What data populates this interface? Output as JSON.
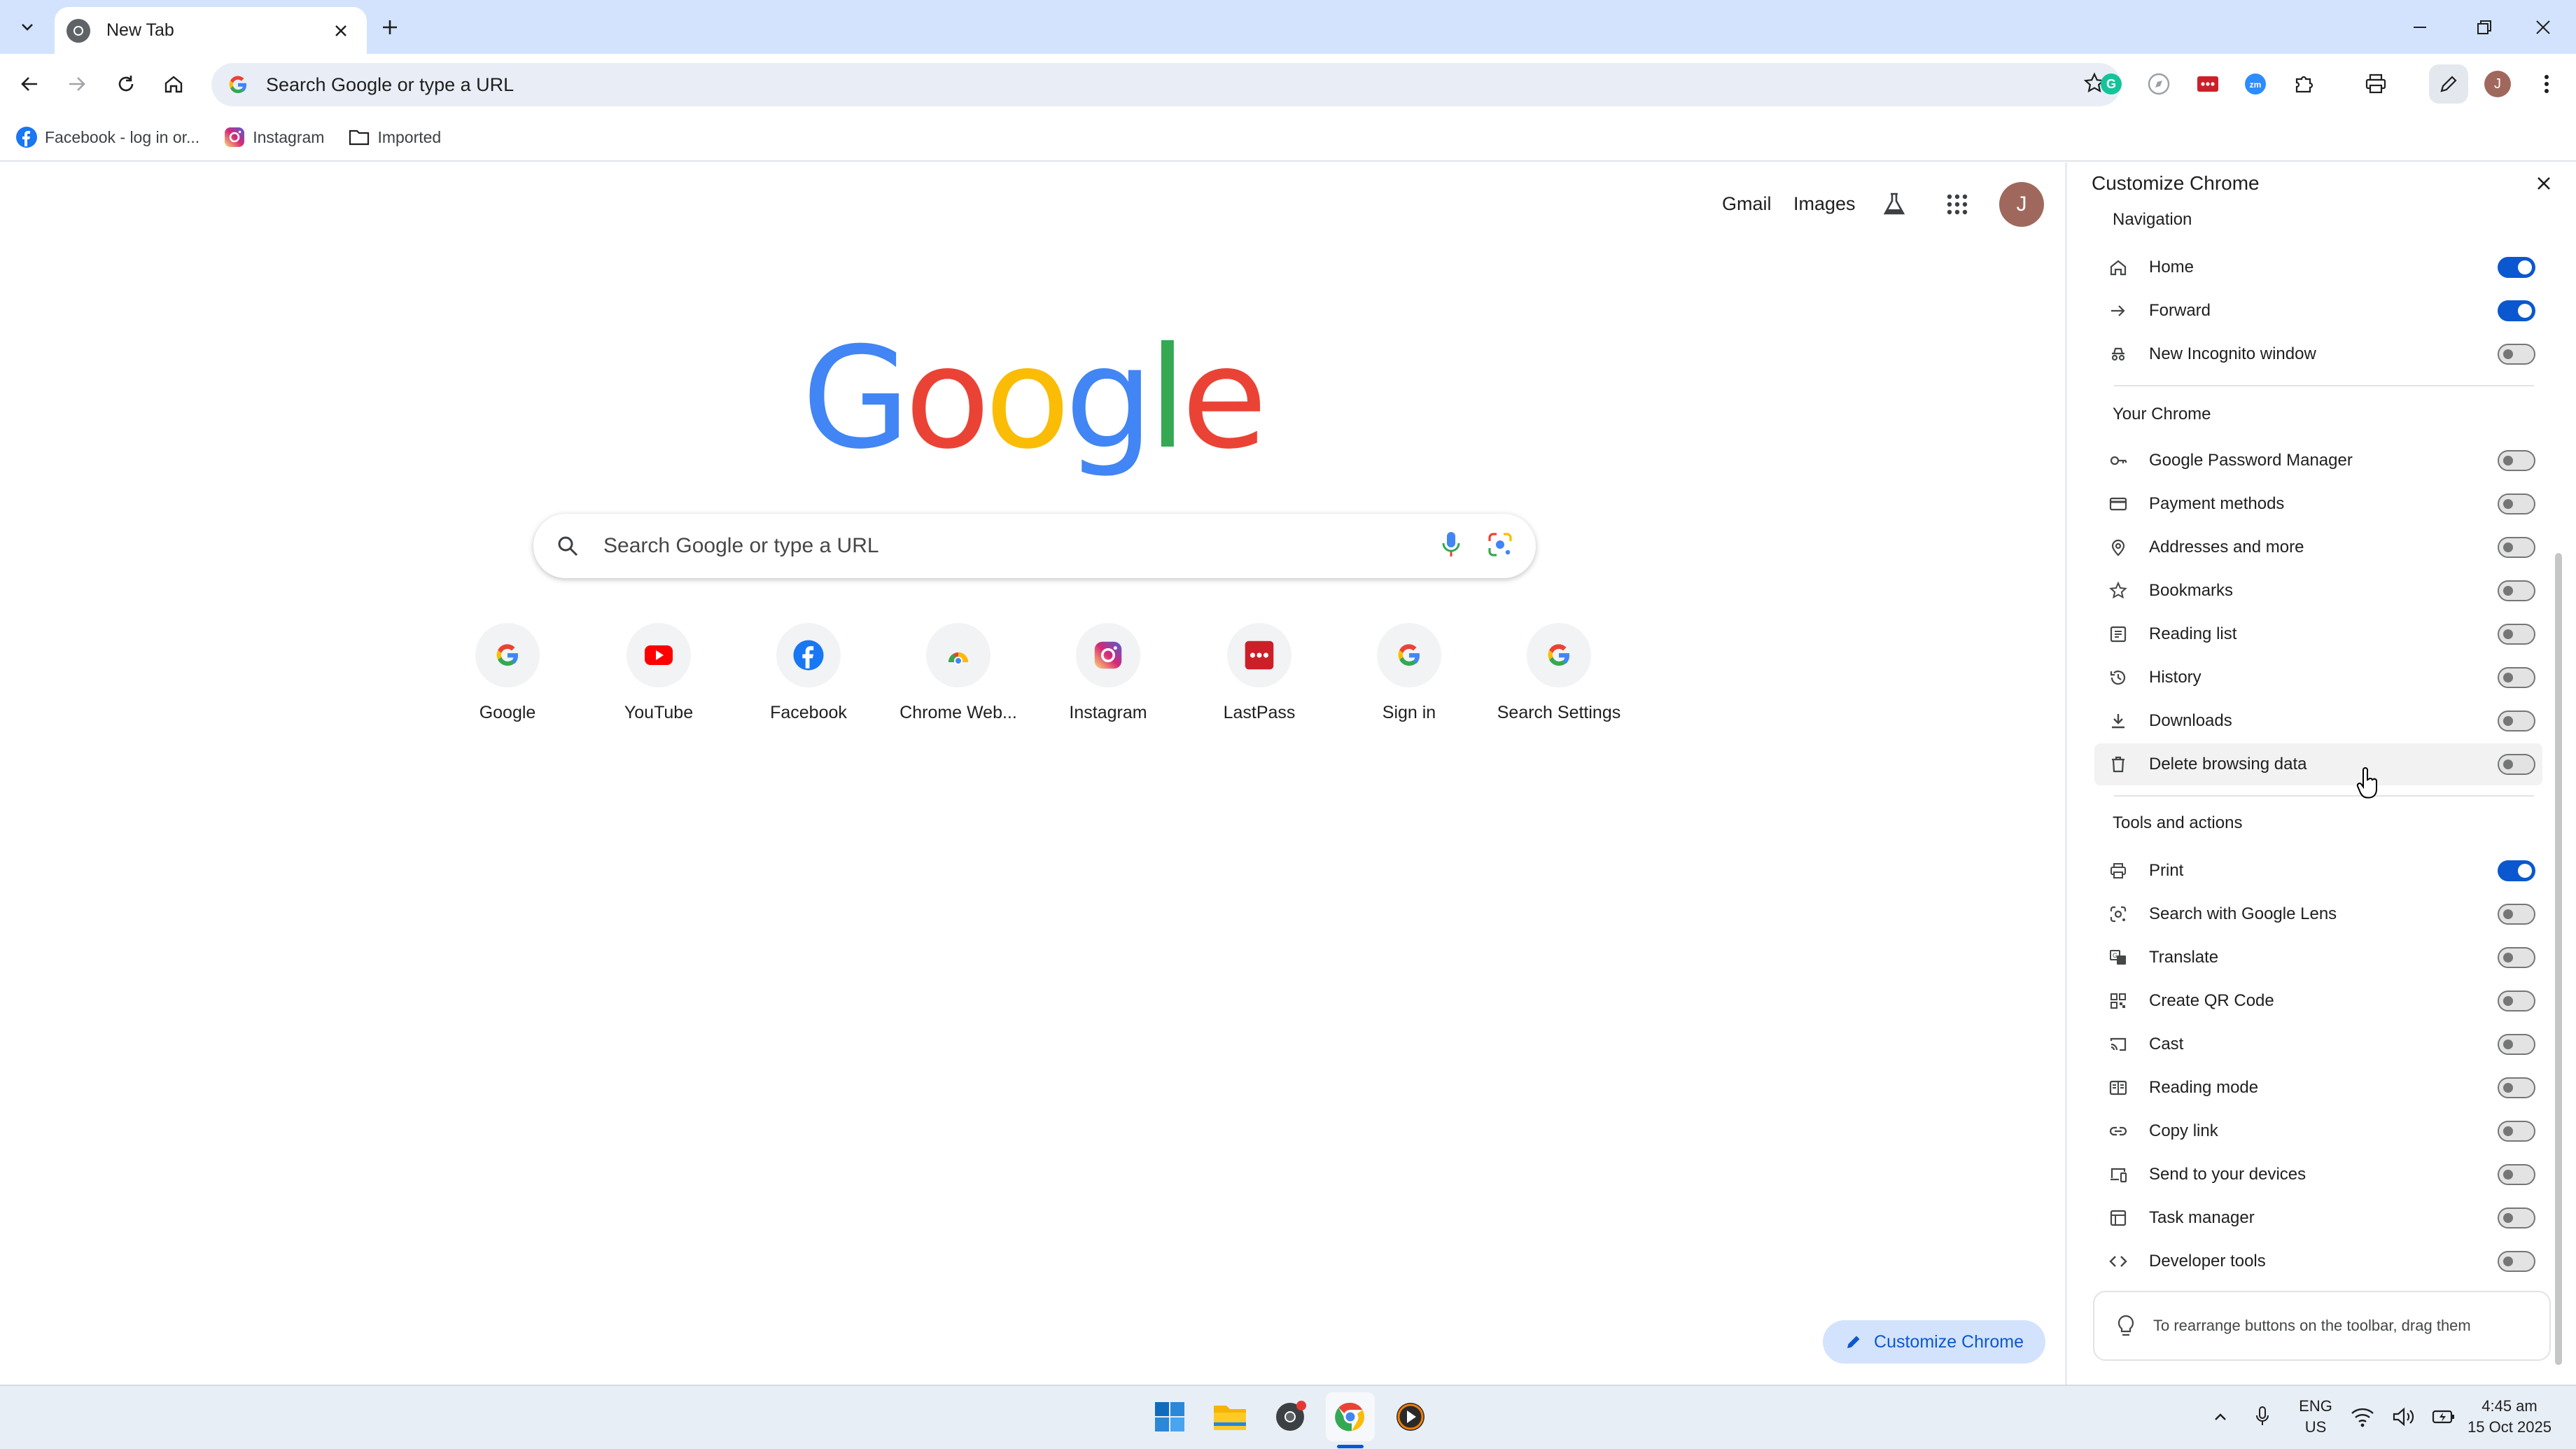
{
  "colors": {
    "tabstrip_bg": "#d3e3fd",
    "accent": "#0b57d0",
    "google_blue": "#4285F4",
    "google_red": "#EA4335",
    "google_yellow": "#FBBC05",
    "google_green": "#34A853",
    "avatar_bg": "#a0685c"
  },
  "tab": {
    "title": "New Tab",
    "favicon": "chrome-icon"
  },
  "toolbar": {
    "omnibox_placeholder": "Search Google or type a URL",
    "avatar_letter": "J",
    "icons": [
      "back-icon",
      "forward-icon",
      "reload-icon",
      "home-icon",
      "bookmark-star-icon",
      "extension-grammarly-icon",
      "extension-compass-icon",
      "extension-lastpass-icon",
      "extension-zoom-icon",
      "extensions-puzzle-icon",
      "print-icon",
      "customize-pencil-icon",
      "profile-avatar",
      "menu-kebab-icon"
    ]
  },
  "bookmarks": [
    {
      "label": "Facebook - log in or...",
      "icon": "facebook-icon"
    },
    {
      "label": "Instagram",
      "icon": "instagram-icon"
    },
    {
      "label": "Imported",
      "icon": "folder-icon"
    }
  ],
  "ntp": {
    "links": {
      "gmail": "Gmail",
      "images": "Images"
    },
    "avatar_letter": "J",
    "logo_letters": [
      "G",
      "o",
      "o",
      "g",
      "l",
      "e"
    ],
    "search_placeholder": "Search Google or type a URL",
    "shortcuts": [
      {
        "label": "Google",
        "icon": "google-g-icon"
      },
      {
        "label": "YouTube",
        "icon": "youtube-icon"
      },
      {
        "label": "Facebook",
        "icon": "facebook-icon"
      },
      {
        "label": "Chrome Web...",
        "icon": "chrome-web-store-icon"
      },
      {
        "label": "Instagram",
        "icon": "instagram-icon"
      },
      {
        "label": "LastPass",
        "icon": "lastpass-icon"
      },
      {
        "label": "Sign in",
        "icon": "google-g-icon"
      },
      {
        "label": "Search Settings",
        "icon": "google-g-icon"
      }
    ],
    "customize_button": "Customize Chrome"
  },
  "side_panel": {
    "title": "Customize Chrome",
    "sections": [
      {
        "heading": "Navigation",
        "items": [
          {
            "label": "Home",
            "icon": "home-icon",
            "enabled": true
          },
          {
            "label": "Forward",
            "icon": "arrow-right-icon",
            "enabled": true
          },
          {
            "label": "New Incognito window",
            "icon": "incognito-icon",
            "enabled": false
          }
        ]
      },
      {
        "heading": "Your Chrome",
        "items": [
          {
            "label": "Google Password Manager",
            "icon": "key-icon",
            "enabled": false
          },
          {
            "label": "Payment methods",
            "icon": "credit-card-icon",
            "enabled": false
          },
          {
            "label": "Addresses and more",
            "icon": "location-pin-icon",
            "enabled": false
          },
          {
            "label": "Bookmarks",
            "icon": "bookmark-star-icon",
            "enabled": false
          },
          {
            "label": "Reading list",
            "icon": "reading-list-icon",
            "enabled": false
          },
          {
            "label": "History",
            "icon": "history-icon",
            "enabled": false
          },
          {
            "label": "Downloads",
            "icon": "download-icon",
            "enabled": false
          },
          {
            "label": "Delete browsing data",
            "icon": "trash-icon",
            "enabled": false
          }
        ]
      },
      {
        "heading": "Tools and actions",
        "items": [
          {
            "label": "Print",
            "icon": "print-icon",
            "enabled": true
          },
          {
            "label": "Search with Google Lens",
            "icon": "lens-icon",
            "enabled": false
          },
          {
            "label": "Translate",
            "icon": "translate-icon",
            "enabled": false
          },
          {
            "label": "Create QR Code",
            "icon": "qr-code-icon",
            "enabled": false
          },
          {
            "label": "Cast",
            "icon": "cast-icon",
            "enabled": false
          },
          {
            "label": "Reading mode",
            "icon": "reading-mode-icon",
            "enabled": false
          },
          {
            "label": "Copy link",
            "icon": "link-icon",
            "enabled": false
          },
          {
            "label": "Send to your devices",
            "icon": "send-to-devices-icon",
            "enabled": false
          },
          {
            "label": "Task manager",
            "icon": "task-manager-icon",
            "enabled": false
          },
          {
            "label": "Developer tools",
            "icon": "code-brackets-icon",
            "enabled": false
          }
        ]
      }
    ],
    "hint": "To rearrange buttons on the toolbar, drag them"
  },
  "taskbar": {
    "apps": [
      "windows-start-icon",
      "file-explorer-icon",
      "chrome-alt-icon",
      "chrome-icon",
      "media-player-icon"
    ],
    "language": "ENG",
    "region": "US",
    "time": "4:45 am",
    "date": "15 Oct 2025"
  }
}
